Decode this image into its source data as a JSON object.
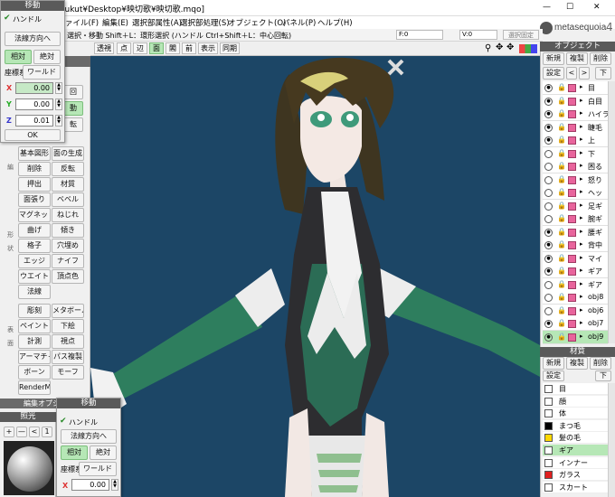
{
  "window": {
    "title_path": "sers¥fukut¥Desktop¥映切歌¥映切歌.mqo]",
    "min": "—",
    "max": "☐",
    "close": "✕"
  },
  "menu": [
    "ァイル(F)",
    "編集(E)",
    "選択部属性(A)",
    "選択部処理(S)",
    "オブジェクト(O)",
    "パネル(P)",
    "ヘルプ(H)"
  ],
  "logo": "metasequoia",
  "logo_num": "4",
  "hint": "選択・移動  Shift＋L：環形選択 (ハンドル  Ctrl+Shift＋L：中心回転)",
  "status": {
    "f": "F:0",
    "v": "V:0",
    "fix": "選択固定"
  },
  "view_toolbar": [
    "透視",
    "点",
    "辺",
    "面",
    "閣",
    "前",
    "表示",
    "同期"
  ],
  "move_top": {
    "title": "移動",
    "handle": "ハンドル",
    "normal": "法線方向へ",
    "relative": "相対",
    "absolute": "絶対",
    "coord_label": "座標系",
    "world": "ワールド",
    "x_label": "X",
    "x": "0.00",
    "y_label": "Y",
    "y": "0.00",
    "z_label": "Z",
    "z": "0.01",
    "ok": "OK"
  },
  "move_bottom": {
    "title": "移動",
    "handle": "ハンドル",
    "normal": "法線方向へ",
    "relative": "相対",
    "absolute": "絶対",
    "coord_label": "座標系",
    "world": "ワールド",
    "x_label": "X",
    "x": "0.00"
  },
  "left_tools": {
    "partial": [
      "回",
      "動",
      "転"
    ],
    "row1": [
      "基本図形",
      "面の生成"
    ],
    "row2": [
      "削除",
      "反転"
    ],
    "row3": [
      "押出",
      "材質"
    ],
    "row4": [
      "面張り",
      "ベベル"
    ],
    "row5": [
      "マグネット",
      "ねじれ"
    ],
    "row6": [
      "曲げ",
      "傾き"
    ],
    "row7": [
      "格子",
      "穴埋め"
    ],
    "row8": [
      "エッジ",
      "ナイフ"
    ],
    "row9": [
      "ウエイト",
      "頂点色"
    ],
    "row10": [
      "法線"
    ],
    "row11": [
      "彫刻",
      "メタボール"
    ],
    "row12": [
      "ペイント",
      "下絵"
    ],
    "row13": [
      "計測",
      "視点"
    ],
    "row14": [
      "アーマチャー",
      "パス複製"
    ],
    "row15": [
      "ボーン",
      "モーフ"
    ],
    "row16": [
      "RenderMan"
    ],
    "side1": "編",
    "side2": "形",
    "side3": "状",
    "side4": "表",
    "side5": "面"
  },
  "edit_options": "編集オプシ",
  "lighting": {
    "title": "照光",
    "plus": "+",
    "minus": "—",
    "lt": "<",
    "one": "1"
  },
  "objects_panel": {
    "title": "オブジェクト",
    "new": "新規",
    "dup": "複製",
    "del": "削除",
    "settings": "設定",
    "lt": "<",
    "gt": ">",
    "bottom": "下",
    "items": [
      "目",
      "白目",
      "ハイラ",
      "睫毛",
      "上",
      "下",
      "困る",
      "怒り",
      "ヘッ",
      "足ギ",
      "腕ギ",
      "腰ギ",
      "背中",
      "マイ",
      "ギア",
      "ギア",
      "obj8",
      "obj6",
      "obj7",
      "obj9"
    ]
  },
  "material_panel": {
    "title": "材質",
    "new": "新規",
    "dup": "複製",
    "del": "削除",
    "settings": "設定",
    "bottom": "下",
    "items": [
      {
        "name": "目",
        "color": "#ffffff"
      },
      {
        "name": "顔",
        "color": "#ffffff"
      },
      {
        "name": "体",
        "color": "#ffffff"
      },
      {
        "name": "まつ毛",
        "color": "#000000"
      },
      {
        "name": "髪の毛",
        "color": "#ffd700"
      },
      {
        "name": "ギア",
        "color": "#ffffff"
      },
      {
        "name": "インナー",
        "color": "#ffffff"
      },
      {
        "name": "ガラス",
        "color": "#e02020"
      },
      {
        "name": "スカート",
        "color": "#ffffff"
      }
    ]
  }
}
